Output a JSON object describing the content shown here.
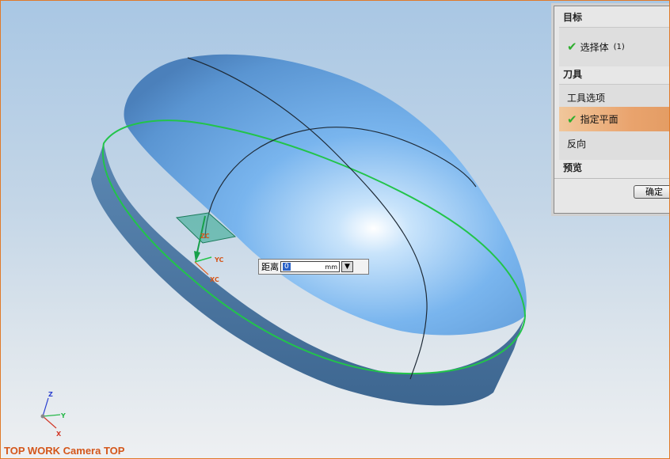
{
  "viewport": {
    "view_label": "TOP WORK Camera TOP",
    "background_color": "#c4d6e7"
  },
  "model": {
    "body_color": "#6aa8e6",
    "wall_color": "#4f7aa4",
    "curve_color": "#22c44a"
  },
  "manipulator": {
    "zc_label": "ZC",
    "yc_label": "YC",
    "xc_label": "XC"
  },
  "triad": {
    "z_label": "Z",
    "y_label": "Y",
    "x_label": "X"
  },
  "distance_input": {
    "label": "距离",
    "value": "0",
    "unit": "mm"
  },
  "dialog": {
    "target_header": "目标",
    "select_body_label": "选择体",
    "select_body_count": "(1)",
    "tool_header": "刀具",
    "tool_option_label": "工具选项",
    "specify_plane_label": "指定平面",
    "reverse_label": "反向",
    "preview_header": "预览",
    "ok_label": "确定"
  }
}
